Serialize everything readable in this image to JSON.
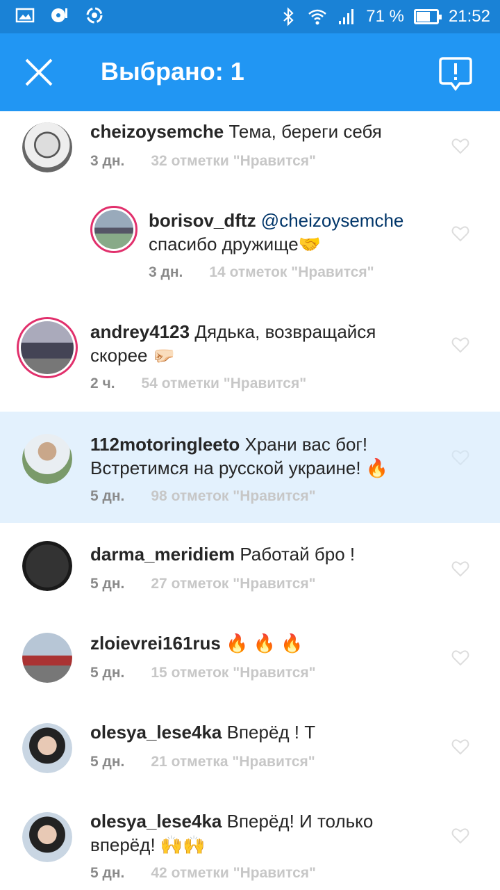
{
  "status_bar": {
    "battery": "71 %",
    "time": "21:52",
    "battery_level": 0.71,
    "icons": [
      "image-icon",
      "music-disc-icon",
      "sync-app-icon",
      "bluetooth-icon",
      "wifi-icon",
      "signal-icon",
      "battery-icon"
    ]
  },
  "toolbar": {
    "title": "Выбрано: 1",
    "close_icon": "close-icon",
    "report_icon": "report-alert-icon",
    "background": "#2196f3"
  },
  "comments": [
    {
      "user": "cheizoysemche",
      "text": " Тема, береги себя",
      "time": "3 дн.",
      "likes": "32 отметки \"Нравится\""
    },
    {
      "user": "borisov_dftz",
      "mention": " @cheizoysemche",
      "text_line2": "спасибо дружище🤝",
      "time": "3 дн.",
      "likes": "14 отметок \"Нравится\""
    },
    {
      "user": "andrey4123",
      "text": " Дядька, возвращайся",
      "text_line2": "скорее 🤛🏻",
      "time": "2 ч.",
      "likes": "54 отметки \"Нравится\""
    },
    {
      "user": "112motoringleeto",
      "text": " Храни вас бог!",
      "text_line2": "Встретимся на русской украине! 🔥",
      "time": "5 дн.",
      "likes": "98 отметок \"Нравится\"",
      "selected": true
    },
    {
      "user": "darma_meridiem",
      "text": " Работай бро !",
      "time": "5 дн.",
      "likes": "27 отметок \"Нравится\""
    },
    {
      "user": "zloievrei161rus",
      "text": " 🔥 🔥 🔥",
      "time": "5 дн.",
      "likes": "15 отметок \"Нравится\""
    },
    {
      "user": "olesya_lese4ka",
      "text": " Вперёд ! Т",
      "time": "5 дн.",
      "likes": "21 отметка \"Нравится\""
    },
    {
      "user": "olesya_lese4ka",
      "text": " Вперёд!  И только",
      "text_line2": "вперёд! 🙌🙌",
      "time": "5 дн.",
      "likes": "42 отметки \"Нравится\""
    }
  ],
  "colors": {
    "selected_row": "#e3f1fd",
    "status_bar": "#1a82d6",
    "story_ring": "#e1306c"
  }
}
